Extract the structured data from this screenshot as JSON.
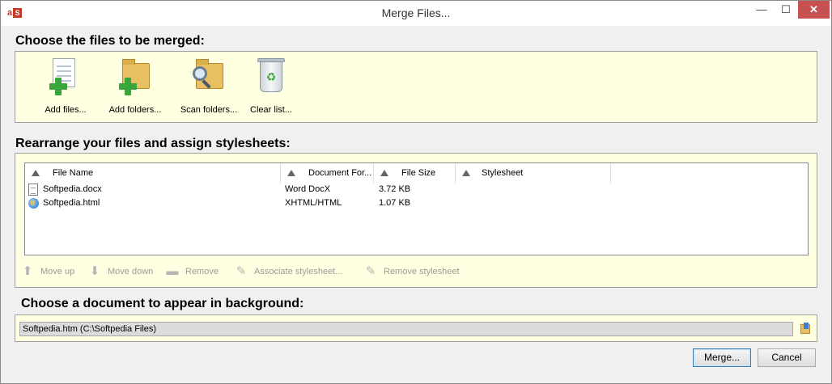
{
  "window": {
    "title": "Merge Files...",
    "app_icon_letters": [
      "a",
      "S"
    ],
    "controls": {
      "minimize": "—",
      "maximize": "☐",
      "close": "✕"
    }
  },
  "choose_files": {
    "heading": "Choose the files to be merged:",
    "tools": [
      {
        "label": "Add files...",
        "icon": "add-files-icon"
      },
      {
        "label": "Add folders...",
        "icon": "add-folders-icon"
      },
      {
        "label": "Scan folders...",
        "icon": "scan-folders-icon"
      },
      {
        "label": "Clear list...",
        "icon": "recycle-bin-icon"
      }
    ]
  },
  "arrange": {
    "heading": "Rearrange your files and assign stylesheets:",
    "columns": [
      "File Name",
      "Document For...",
      "File Size",
      "Stylesheet"
    ],
    "rows": [
      {
        "name": "Softpedia.docx",
        "format": "Word DocX",
        "size": "3.72 KB",
        "stylesheet": "",
        "icon": "docx-file-icon"
      },
      {
        "name": "Softpedia.html",
        "format": "XHTML/HTML",
        "size": "1.07 KB",
        "stylesheet": "",
        "icon": "html-file-icon"
      }
    ],
    "actions": [
      {
        "label": "Move up",
        "icon": "arrow-up-icon",
        "glyph": "⬆"
      },
      {
        "label": "Move down",
        "icon": "arrow-down-icon",
        "glyph": "⬇"
      },
      {
        "label": "Remove",
        "icon": "minus-icon",
        "glyph": "▬"
      },
      {
        "label": "Associate stylesheet...",
        "icon": "associate-stylesheet-icon",
        "glyph": "✎"
      },
      {
        "label": "Remove stylesheet",
        "icon": "remove-stylesheet-icon",
        "glyph": "✎"
      }
    ]
  },
  "background": {
    "heading": "Choose a document to appear in background:",
    "value": "Softpedia.htm (C:\\Softpedia Files)"
  },
  "buttons": {
    "merge": "Merge...",
    "cancel": "Cancel"
  },
  "colors": {
    "panel": "#ffffe1",
    "close": "#c75050",
    "plus": "#3aa53a"
  }
}
